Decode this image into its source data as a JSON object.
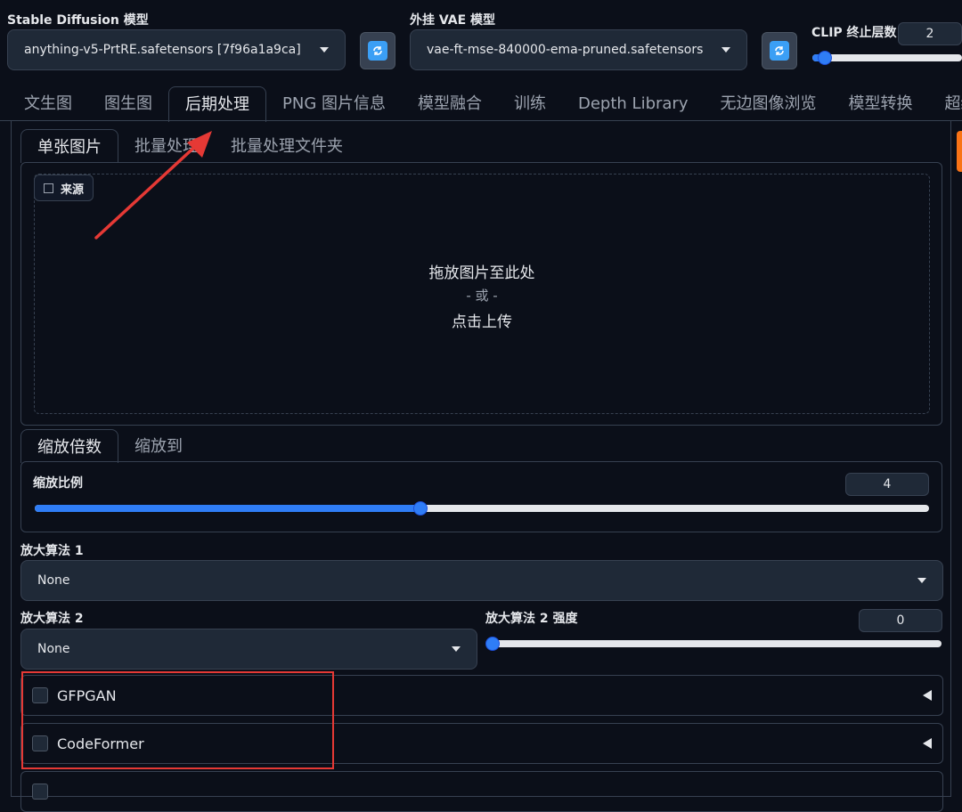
{
  "top": {
    "sd_model_label": "Stable Diffusion 模型",
    "sd_model_value": "anything-v5-PrtRE.safetensors [7f96a1a9ca]",
    "vae_label": "外挂 VAE 模型",
    "vae_value": "vae-ft-mse-840000-ema-pruned.safetensors",
    "clip_label": "CLIP 终止层数",
    "clip_value": "2",
    "clip_slider_fraction": 0.08
  },
  "main_tabs": [
    "文生图",
    "图生图",
    "后期处理",
    "PNG 图片信息",
    "模型融合",
    "训练",
    "Depth Library",
    "无边图像浏览",
    "模型转换",
    "超级"
  ],
  "main_tab_active": "后期处理",
  "sub_tabs": [
    "单张图片",
    "批量处理",
    "批量处理文件夹"
  ],
  "source": {
    "badge": "来源",
    "drop_text": "拖放图片至此处",
    "or_text": "- 或 -",
    "upload_text": "点击上传"
  },
  "resize_tabs": [
    "缩放倍数",
    "缩放到"
  ],
  "scale": {
    "label": "缩放比例",
    "value": "4",
    "slider_fraction": 0.43
  },
  "upscaler1": {
    "label": "放大算法 1",
    "value": "None"
  },
  "upscaler2": {
    "label": "放大算法 2",
    "value": "None"
  },
  "upscaler2_strength": {
    "label": "放大算法 2 强度",
    "value": "0",
    "slider_fraction": 0.0
  },
  "accordions": [
    "GFPGAN",
    "CodeFormer"
  ],
  "colors": {
    "background": "#0b0f19",
    "accent": "#2f7df6",
    "highlight_box": "#e53935",
    "arrow": "#e53935"
  }
}
